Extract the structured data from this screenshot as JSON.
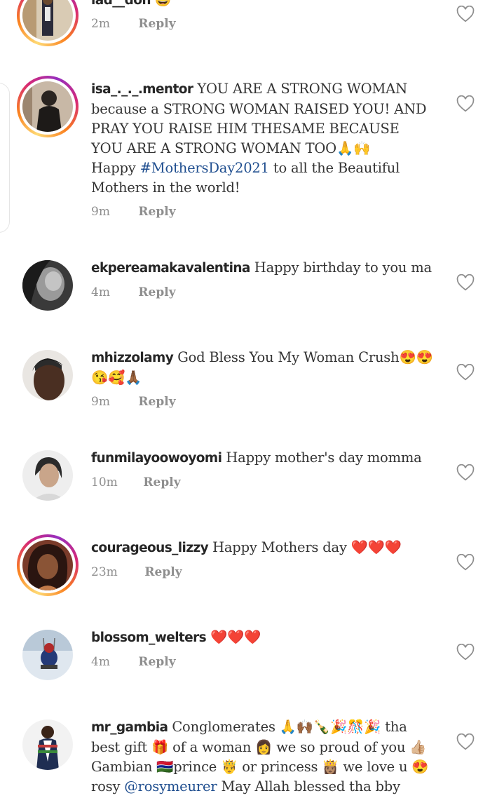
{
  "comments": [
    {
      "username": "lad__doh",
      "text": "",
      "emoji_tail": "😆",
      "time": "2m",
      "reply": "Reply",
      "avatar": "avatar-photo",
      "story_ring": true
    },
    {
      "username": "isa_._._.mentor",
      "text": "YOU ARE A STRONG WOMAN because a STRONG WOMAN RAISED YOU! AND PRAY YOU RAISE HIM THESAME BECAUSE YOU ARE A STRONG WOMAN TOO🙏🙌",
      "text2_pre": "Happy ",
      "hashtag": "#MothersDay2021",
      "text2_post": " to all the Beautiful Mothers in the world!",
      "time": "9m",
      "reply": "Reply",
      "avatar": "avatar-photo",
      "story_ring": true
    },
    {
      "username": "ekpereamakavalentina",
      "text": "Happy birthday to you ma",
      "time": "4m",
      "reply": "Reply",
      "avatar": "avatar-photo",
      "story_ring": false
    },
    {
      "username": "mhizzolamy",
      "text": "God Bless You My Woman Crush😍😍😘🥰🙏🏾",
      "time": "9m",
      "reply": "Reply",
      "avatar": "avatar-photo",
      "story_ring": false
    },
    {
      "username": "funmilayoowoyomi",
      "text": "Happy mother's day momma",
      "time": "10m",
      "reply": "Reply",
      "avatar": "avatar-photo",
      "story_ring": false
    },
    {
      "username": "courageous_lizzy",
      "text": "Happy Mothers day ❤️❤️❤️",
      "time": "23m",
      "reply": "Reply",
      "avatar": "avatar-photo",
      "story_ring": true
    },
    {
      "username": "blossom_welters",
      "text": "❤️❤️❤️",
      "time": "4m",
      "reply": "Reply",
      "avatar": "avatar-photo",
      "story_ring": false
    },
    {
      "username": "mr_gambia",
      "text_pre": "Conglomerates 🙏🙌🏾🍾🎉🎊🎉 tha best gift 🎁 of a woman 👩 we so proud of you 👍🏼 Gambian 🇬🇲prince 🤴 or princess 👸🏽 we love u 😍 rosy ",
      "mention": "@rosymeurer",
      "text_post": " May Allah blessed tha bby",
      "avatar": "avatar-photo",
      "story_ring": false
    }
  ],
  "icons": {
    "like": "heart-outline-icon"
  },
  "colors": {
    "link": "#1f4e8f",
    "meta": "#8e8e8e",
    "ring_start": "#feda75",
    "ring_end": "#962fbf"
  }
}
